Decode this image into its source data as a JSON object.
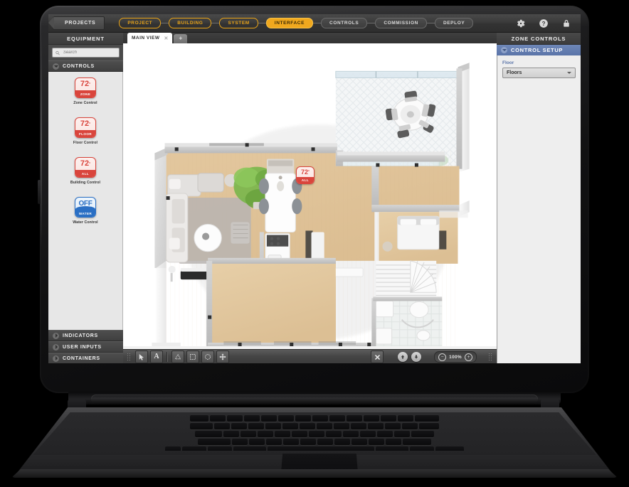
{
  "topnav": {
    "back_button": "PROJECTS",
    "crumbs": [
      {
        "label": "PROJECT",
        "state": "outline"
      },
      {
        "label": "BUILDING",
        "state": "outline"
      },
      {
        "label": "SYSTEM",
        "state": "outline"
      },
      {
        "label": "INTERFACE",
        "state": "active"
      },
      {
        "label": "CONTROLS",
        "state": "plain"
      },
      {
        "label": "COMMISSION",
        "state": "plain"
      },
      {
        "label": "DEPLOY",
        "state": "plain"
      }
    ],
    "icons": [
      {
        "name": "gear-icon",
        "label": "Settings"
      },
      {
        "name": "help-icon",
        "label": "Help"
      },
      {
        "name": "lock-icon",
        "label": "Lock"
      }
    ]
  },
  "sidebar": {
    "title": "EQUIPMENT",
    "search_placeholder": "Search",
    "search_value": "",
    "sections": [
      {
        "label": "CONTROLS",
        "expanded": true
      },
      {
        "label": "INDICATORS",
        "expanded": false
      },
      {
        "label": "USER INPUTS",
        "expanded": false
      },
      {
        "label": "CONTAINERS",
        "expanded": false
      }
    ],
    "palette": [
      {
        "label": "Zone Control",
        "value": "72",
        "unit": "°",
        "mode": "ZONE",
        "color": "#d9453c",
        "style": "red"
      },
      {
        "label": "Floor Control",
        "value": "72",
        "unit": "°",
        "mode": "FLOOR",
        "color": "#d9453c",
        "style": "red"
      },
      {
        "label": "Building Control",
        "value": "72",
        "unit": "°",
        "mode": "ALL",
        "color": "#d9453c",
        "style": "red"
      },
      {
        "label": "Water Control",
        "value": "OFF",
        "unit": "",
        "mode": "WATER",
        "color": "#2a6fc4",
        "style": "blue"
      }
    ]
  },
  "center": {
    "tab_label": "MAIN VIEW",
    "tab_close": "✕",
    "tab_add": "+",
    "canvas_widget": {
      "value": "72",
      "unit": "°",
      "mode": "ALL",
      "color": "#d9453c"
    }
  },
  "toolbar": {
    "tools": [
      {
        "name": "select-arrow-tool",
        "glyph": "arrow"
      },
      {
        "name": "text-tool",
        "glyph": "A"
      }
    ],
    "shape_tools": [
      {
        "name": "polygon-select-tool",
        "glyph": "polygon"
      },
      {
        "name": "rect-select-tool",
        "glyph": "rect"
      },
      {
        "name": "ellipse-select-tool",
        "glyph": "ellipse"
      },
      {
        "name": "move-tool",
        "glyph": "move"
      }
    ],
    "delete_label": "✖",
    "layer_up_label": "layer-up-icon",
    "layer_down_label": "layer-down-icon",
    "zoom_out": "−",
    "zoom_level": "100%",
    "zoom_in": "+"
  },
  "rpanel": {
    "title": "ZONE CONTROLS",
    "section": "CONTROL SETUP",
    "field_label": "Floor",
    "field_value": "Floors"
  }
}
